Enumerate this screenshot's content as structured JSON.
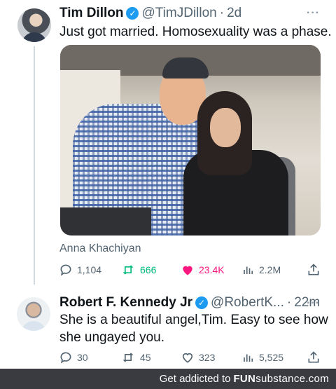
{
  "tweet1": {
    "name": "Tim Dillon",
    "handle": "@TimJDillon",
    "sep": "·",
    "time": "2d",
    "more": "···",
    "text": "Just got married. Homosexuality was a phase.",
    "photo_caption": "Anna Khachiyan",
    "stats": {
      "replies": "1,104",
      "retweets": "666",
      "likes": "23.4K",
      "views": "2.2M"
    }
  },
  "tweet2": {
    "name": "Robert F. Kennedy Jr",
    "handle": "@RobertK...",
    "sep": "·",
    "time": "22m",
    "more": "···",
    "text_line1": "She is a beautiful angel,Tim. Easy to see how",
    "text_line2": "she ungayed you.",
    "stats": {
      "replies": "30",
      "retweets": "45",
      "likes": "323",
      "views": "5,525"
    }
  },
  "footer": {
    "text": "Get addicted to",
    "brand_bold": "FUN",
    "brand_rest": "substance",
    "suffix": ".com"
  },
  "colors": {
    "verified": "#1d9bf0",
    "like_pink": "#f91880",
    "retweet_green": "#00ba7c",
    "muted": "#536471"
  }
}
